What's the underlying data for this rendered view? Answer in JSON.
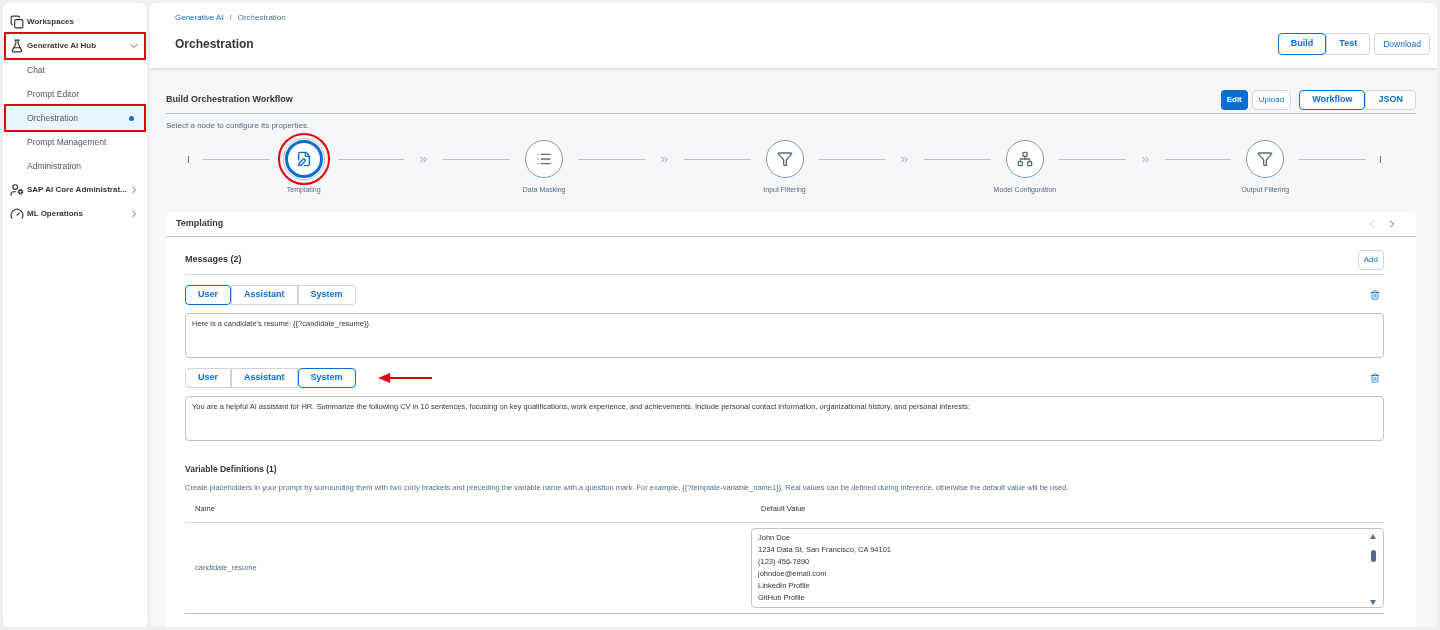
{
  "sidebar": {
    "items": [
      {
        "label": "Workspaces",
        "kind": "link",
        "selected": false,
        "highlighted": false
      },
      {
        "label": "Generative AI Hub",
        "kind": "section",
        "selected": false,
        "highlighted": true,
        "expanded": true
      },
      {
        "label": "Chat",
        "kind": "sub",
        "selected": false,
        "highlighted": false,
        "dot": false
      },
      {
        "label": "Prompt Editor",
        "kind": "sub",
        "selected": false,
        "highlighted": false,
        "dot": false
      },
      {
        "label": "Orchestration",
        "kind": "sub",
        "selected": true,
        "highlighted": true,
        "dot": true
      },
      {
        "label": "Prompt Management",
        "kind": "sub",
        "selected": false,
        "highlighted": false,
        "dot": false
      },
      {
        "label": "Administration",
        "kind": "sub",
        "selected": false,
        "highlighted": false,
        "dot": false
      },
      {
        "label": "SAP AI Core Administrat...",
        "kind": "section",
        "selected": false,
        "highlighted": false,
        "expanded": false
      },
      {
        "label": "ML Operations",
        "kind": "section",
        "selected": false,
        "highlighted": false,
        "expanded": false
      }
    ]
  },
  "breadcrumbs": [
    {
      "label": "Generative AI",
      "kind": "link"
    },
    {
      "label": "/",
      "kind": "separator"
    },
    {
      "label": "Orchestration",
      "kind": "current"
    }
  ],
  "page_title": "Orchestration",
  "mode_tabs": [
    {
      "label": "Build",
      "selected": true
    },
    {
      "label": "Test",
      "selected": false
    }
  ],
  "download_button": "Download",
  "workflow": {
    "title": "Build Orchestration Workflow",
    "edit_button": "Edit",
    "upload_button": "Upload",
    "view_tabs": [
      {
        "label": "Workflow",
        "selected": true
      },
      {
        "label": "JSON",
        "selected": false
      }
    ],
    "hint": "Select a node to configure its properties.",
    "nodes": [
      {
        "label": "Templating",
        "kind": "templating",
        "selected": true,
        "highlighted": true
      },
      {
        "label": "Data Masking",
        "kind": "masking",
        "selected": false,
        "highlighted": false
      },
      {
        "label": "Input Filtering",
        "kind": "filter",
        "selected": false,
        "highlighted": false
      },
      {
        "label": "Model Configuration",
        "kind": "model",
        "selected": false,
        "highlighted": false
      },
      {
        "label": "Output Filtering",
        "kind": "filter",
        "selected": false,
        "highlighted": false
      }
    ]
  },
  "templating": {
    "title": "Templating",
    "prev_disabled": true,
    "next_disabled": false,
    "messages_title": "Messages (2)",
    "add_button": "Add",
    "messages": [
      {
        "roles": [
          {
            "label": "User",
            "selected": true
          },
          {
            "label": "Assistant",
            "selected": false
          },
          {
            "label": "System",
            "selected": false
          }
        ],
        "text": "Here is a candidate's resume: {{?candidate_resume}}",
        "arrow": false
      },
      {
        "roles": [
          {
            "label": "User",
            "selected": false
          },
          {
            "label": "Assistant",
            "selected": false
          },
          {
            "label": "System",
            "selected": true
          }
        ],
        "text": "You are a helpful AI assistant for HR. Summarize the following CV in 10 sentences, focusing on key qualifications, work experience, and achievements. Include personal contact information, organizational history, and personal interests:",
        "arrow": true
      }
    ],
    "variables_title": "Variable Definitions (1)",
    "variables_hint": "Create placeholders in your prompt by surrounding them with two curly brackets and preceding the variable name with a question mark. For example, {{?template-variable_name1}}. Real values can be defined during inference, otherwise the default value will be used.",
    "table": {
      "columns": [
        "Name",
        "Default Value"
      ],
      "rows": [
        {
          "name": "candidate_resume",
          "default_value": [
            "John Doe",
            "1234 Data St, San Francisco, CA 94101",
            "(123) 456-7890",
            "johndoe@email.com",
            "LinkedIn Profile",
            "GitHub Profile"
          ]
        }
      ]
    }
  }
}
